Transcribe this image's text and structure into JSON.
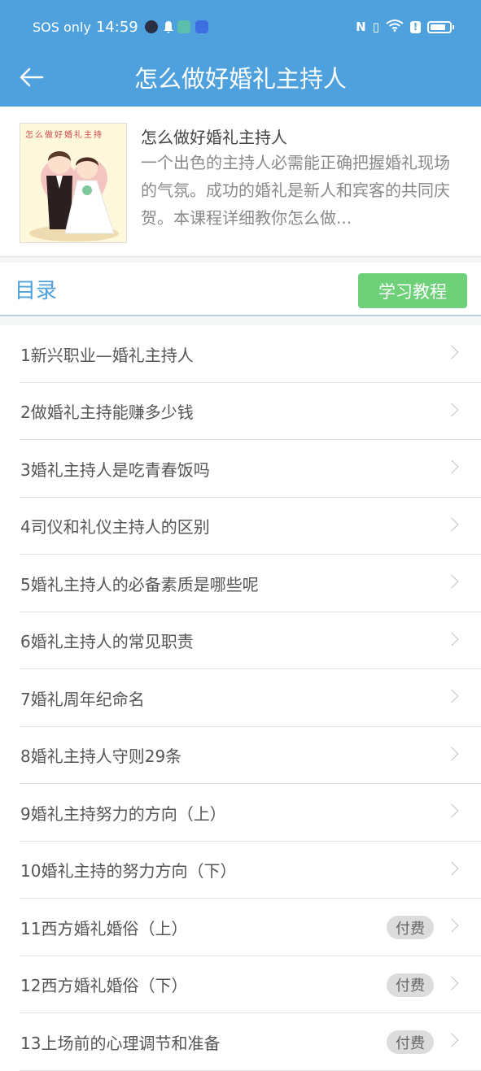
{
  "status_bar": {
    "carrier": "SOS only",
    "time": "14:59",
    "network": "6"
  },
  "header": {
    "title": "怎么做好婚礼主持人",
    "back_icon": "arrow-left-icon"
  },
  "course": {
    "cover_text": "怎么做好婚礼主持",
    "title": "怎么做好婚礼主持人",
    "description": "一个出色的主持人必需能正确把握婚礼现场的气氛。成功的婚礼是新人和宾客的共同庆贺。本课程详细教你怎么做..."
  },
  "catalog": {
    "title": "目录",
    "learn_button": "学习教程"
  },
  "lessons": [
    {
      "label": "1新兴职业—婚礼主持人",
      "badge": null
    },
    {
      "label": "2做婚礼主持能赚多少钱",
      "badge": null
    },
    {
      "label": "3婚礼主持人是吃青春饭吗",
      "badge": null
    },
    {
      "label": "4司仪和礼仪主持人的区别",
      "badge": null
    },
    {
      "label": "5婚礼主持人的必备素质是哪些呢",
      "badge": null
    },
    {
      "label": "6婚礼主持人的常见职责",
      "badge": null
    },
    {
      "label": "7婚礼周年纪命名",
      "badge": null
    },
    {
      "label": "8婚礼主持人守则29条",
      "badge": null
    },
    {
      "label": "9婚礼主持努力的方向（上）",
      "badge": null
    },
    {
      "label": "10婚礼主持的努力方向（下）",
      "badge": null
    },
    {
      "label": "11西方婚礼婚俗（上）",
      "badge": "付费"
    },
    {
      "label": "12西方婚礼婚俗（下）",
      "badge": "付费"
    },
    {
      "label": "13上场前的心理调节和准备",
      "badge": "付费"
    }
  ]
}
